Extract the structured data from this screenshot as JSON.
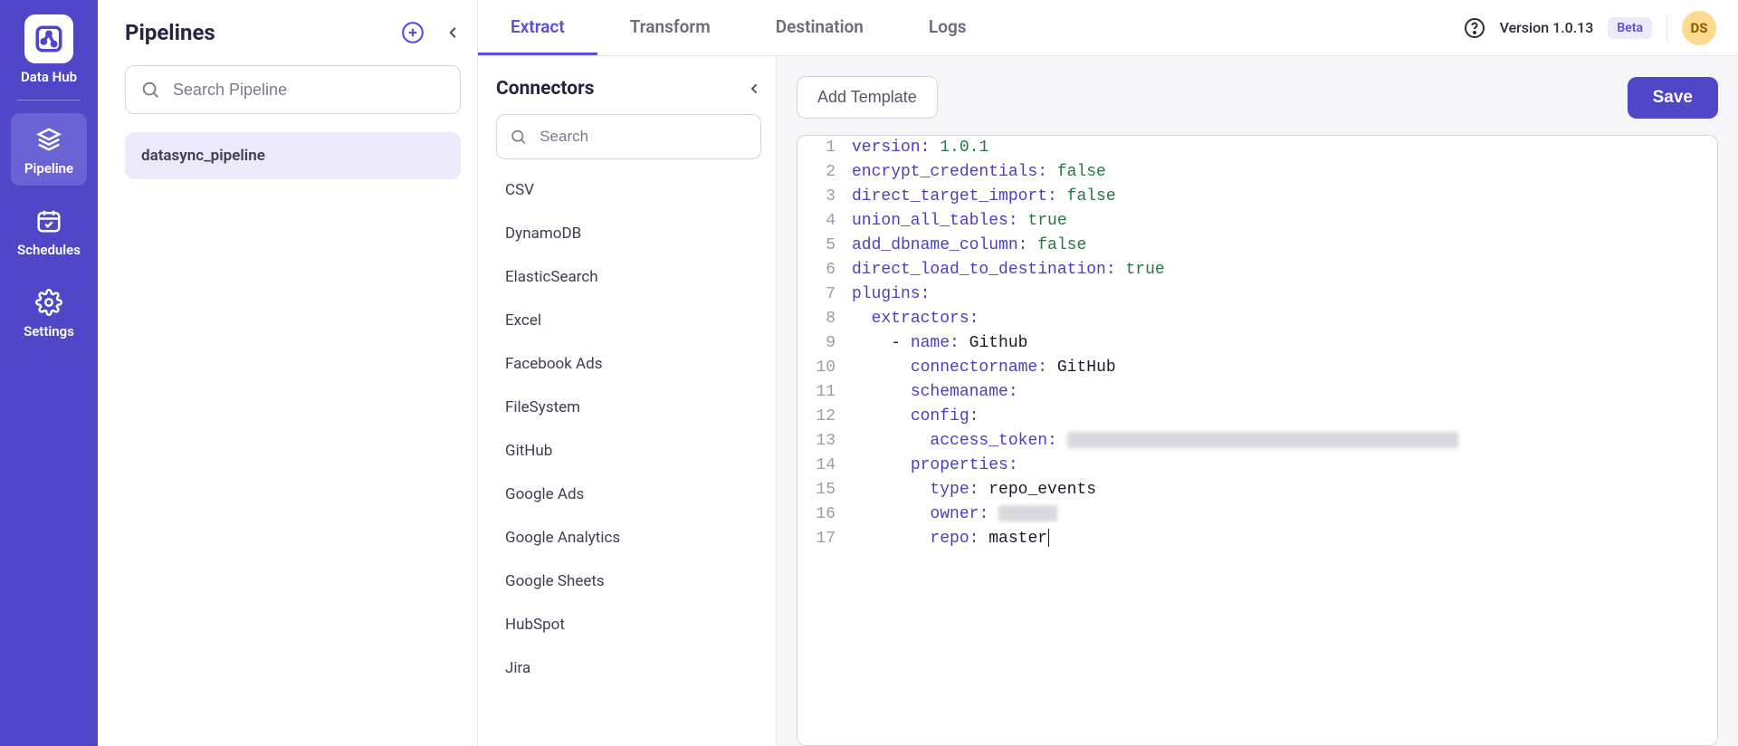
{
  "rail": {
    "logo_label": "Data Hub",
    "items": [
      {
        "id": "pipeline",
        "label": "Pipeline",
        "selected": true
      },
      {
        "id": "schedules",
        "label": "Schedules",
        "selected": false
      },
      {
        "id": "settings",
        "label": "Settings",
        "selected": false
      }
    ]
  },
  "pipelines": {
    "title": "Pipelines",
    "search_placeholder": "Search Pipeline",
    "items": [
      {
        "name": "datasync_pipeline",
        "selected": true
      }
    ]
  },
  "tabs": [
    {
      "id": "extract",
      "label": "Extract",
      "active": true
    },
    {
      "id": "transform",
      "label": "Transform",
      "active": false
    },
    {
      "id": "destination",
      "label": "Destination",
      "active": false
    },
    {
      "id": "logs",
      "label": "Logs",
      "active": false
    }
  ],
  "header": {
    "version_text": "Version 1.0.13",
    "beta_label": "Beta",
    "avatar_initials": "DS"
  },
  "connectors": {
    "title": "Connectors",
    "search_placeholder": "Search",
    "items": [
      "CSV",
      "DynamoDB",
      "ElasticSearch",
      "Excel",
      "Facebook Ads",
      "FileSystem",
      "GitHub",
      "Google Ads",
      "Google Analytics",
      "Google Sheets",
      "HubSpot",
      "Jira"
    ]
  },
  "editor_toolbar": {
    "add_template_label": "Add Template",
    "save_label": "Save"
  },
  "code": {
    "lines": [
      {
        "n": 1,
        "tokens": [
          {
            "t": "version",
            "c": "key"
          },
          {
            "t": ": ",
            "c": "punct"
          },
          {
            "t": "1.0.1",
            "c": "num"
          }
        ]
      },
      {
        "n": 2,
        "tokens": [
          {
            "t": "encrypt_credentials",
            "c": "key"
          },
          {
            "t": ": ",
            "c": "punct"
          },
          {
            "t": "false",
            "c": "num"
          }
        ]
      },
      {
        "n": 3,
        "tokens": [
          {
            "t": "direct_target_import",
            "c": "key"
          },
          {
            "t": ": ",
            "c": "punct"
          },
          {
            "t": "false",
            "c": "num"
          }
        ]
      },
      {
        "n": 4,
        "tokens": [
          {
            "t": "union_all_tables",
            "c": "key"
          },
          {
            "t": ": ",
            "c": "punct"
          },
          {
            "t": "true",
            "c": "num"
          }
        ]
      },
      {
        "n": 5,
        "tokens": [
          {
            "t": "add_dbname_column",
            "c": "key"
          },
          {
            "t": ": ",
            "c": "punct"
          },
          {
            "t": "false",
            "c": "num"
          }
        ]
      },
      {
        "n": 6,
        "tokens": [
          {
            "t": "direct_load_to_destination",
            "c": "key"
          },
          {
            "t": ": ",
            "c": "punct"
          },
          {
            "t": "true",
            "c": "num"
          }
        ]
      },
      {
        "n": 7,
        "tokens": [
          {
            "t": "plugins",
            "c": "key"
          },
          {
            "t": ":",
            "c": "punct"
          }
        ]
      },
      {
        "n": 8,
        "tokens": [
          {
            "t": "  ",
            "c": "val"
          },
          {
            "t": "extractors",
            "c": "key"
          },
          {
            "t": ":",
            "c": "punct"
          }
        ]
      },
      {
        "n": 9,
        "tokens": [
          {
            "t": "    - ",
            "c": "val"
          },
          {
            "t": "name",
            "c": "key"
          },
          {
            "t": ": ",
            "c": "punct"
          },
          {
            "t": "Github",
            "c": "val"
          }
        ]
      },
      {
        "n": 10,
        "tokens": [
          {
            "t": "      ",
            "c": "val"
          },
          {
            "t": "connectorname",
            "c": "key"
          },
          {
            "t": ": ",
            "c": "punct"
          },
          {
            "t": "GitHub",
            "c": "val"
          }
        ]
      },
      {
        "n": 11,
        "tokens": [
          {
            "t": "      ",
            "c": "val"
          },
          {
            "t": "schemaname",
            "c": "key"
          },
          {
            "t": ":",
            "c": "punct"
          }
        ]
      },
      {
        "n": 12,
        "tokens": [
          {
            "t": "      ",
            "c": "val"
          },
          {
            "t": "config",
            "c": "key"
          },
          {
            "t": ":",
            "c": "punct"
          }
        ]
      },
      {
        "n": 13,
        "tokens": [
          {
            "t": "        ",
            "c": "val"
          },
          {
            "t": "access_token",
            "c": "key"
          },
          {
            "t": ": ",
            "c": "punct"
          },
          {
            "t": "xxxxxxxxxxxxxxxxxxxxxxxxxxxxxxxxxxxxxxxx",
            "c": "redacted"
          }
        ]
      },
      {
        "n": 14,
        "tokens": [
          {
            "t": "      ",
            "c": "val"
          },
          {
            "t": "properties",
            "c": "key"
          },
          {
            "t": ":",
            "c": "punct"
          }
        ]
      },
      {
        "n": 15,
        "tokens": [
          {
            "t": "        ",
            "c": "val"
          },
          {
            "t": "type",
            "c": "key"
          },
          {
            "t": ": ",
            "c": "punct"
          },
          {
            "t": "repo_events",
            "c": "val"
          }
        ]
      },
      {
        "n": 16,
        "tokens": [
          {
            "t": "        ",
            "c": "val"
          },
          {
            "t": "owner",
            "c": "key"
          },
          {
            "t": ": ",
            "c": "punct"
          },
          {
            "t": "xxxxxx",
            "c": "redacted"
          }
        ]
      },
      {
        "n": 17,
        "tokens": [
          {
            "t": "        ",
            "c": "val"
          },
          {
            "t": "repo",
            "c": "key"
          },
          {
            "t": ": ",
            "c": "punct"
          },
          {
            "t": "master",
            "c": "val"
          }
        ],
        "caret": true
      }
    ]
  }
}
